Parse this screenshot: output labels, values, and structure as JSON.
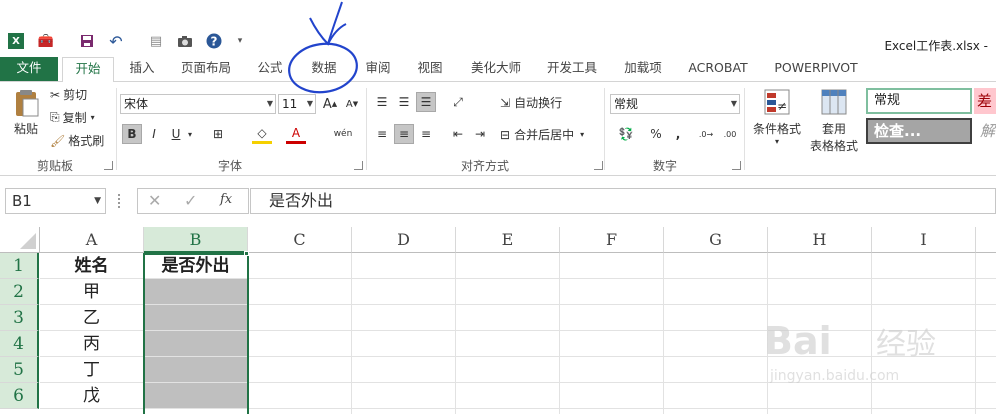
{
  "window": {
    "title": "Excel工作表.xlsx - "
  },
  "tabs": [
    {
      "label": "文件"
    },
    {
      "label": "开始"
    },
    {
      "label": "插入"
    },
    {
      "label": "页面布局"
    },
    {
      "label": "公式"
    },
    {
      "label": "数据"
    },
    {
      "label": "审阅"
    },
    {
      "label": "视图"
    },
    {
      "label": "美化大师"
    },
    {
      "label": "开发工具"
    },
    {
      "label": "加载项"
    },
    {
      "label": "ACROBAT"
    },
    {
      "label": "POWERPIVOT"
    }
  ],
  "ribbon": {
    "clipboard": {
      "paste": "粘贴",
      "cut": "剪切",
      "copy": "复制",
      "format_painter": "格式刷",
      "group": "剪贴板"
    },
    "font": {
      "name": "宋体",
      "size": "11",
      "group": "字体",
      "bold": "B",
      "italic": "I",
      "underline": "U",
      "grow": "A",
      "shrink": "A",
      "font_color": "A",
      "phonetic": "wén"
    },
    "alignment": {
      "wrap": "自动换行",
      "merge": "合并后居中",
      "group": "对齐方式"
    },
    "number": {
      "format": "常规",
      "percent": "%",
      "comma": ",",
      "group": "数字"
    },
    "styles": {
      "conditional": "条件格式",
      "table1": "套用",
      "table2": "表格格式",
      "style_normal": "常规",
      "style_bad": "差",
      "style_check": "检查...",
      "style_explain": "解"
    }
  },
  "formula_bar": {
    "name_box": "B1",
    "content": "是否外出",
    "fx": "fx"
  },
  "sheet": {
    "columns": [
      "A",
      "B",
      "C",
      "D",
      "E",
      "F",
      "G",
      "H",
      "I"
    ],
    "rows": [
      "1",
      "2",
      "3",
      "4",
      "5",
      "6"
    ],
    "cells": {
      "A": [
        "姓名",
        "甲",
        "乙",
        "丙",
        "丁",
        "戊"
      ],
      "B": [
        "是否外出",
        "",
        "",
        "",
        "",
        ""
      ]
    }
  },
  "colors": {
    "accent": "#217346",
    "selection": "#bfbfbf",
    "annotation": "#2244cc"
  }
}
